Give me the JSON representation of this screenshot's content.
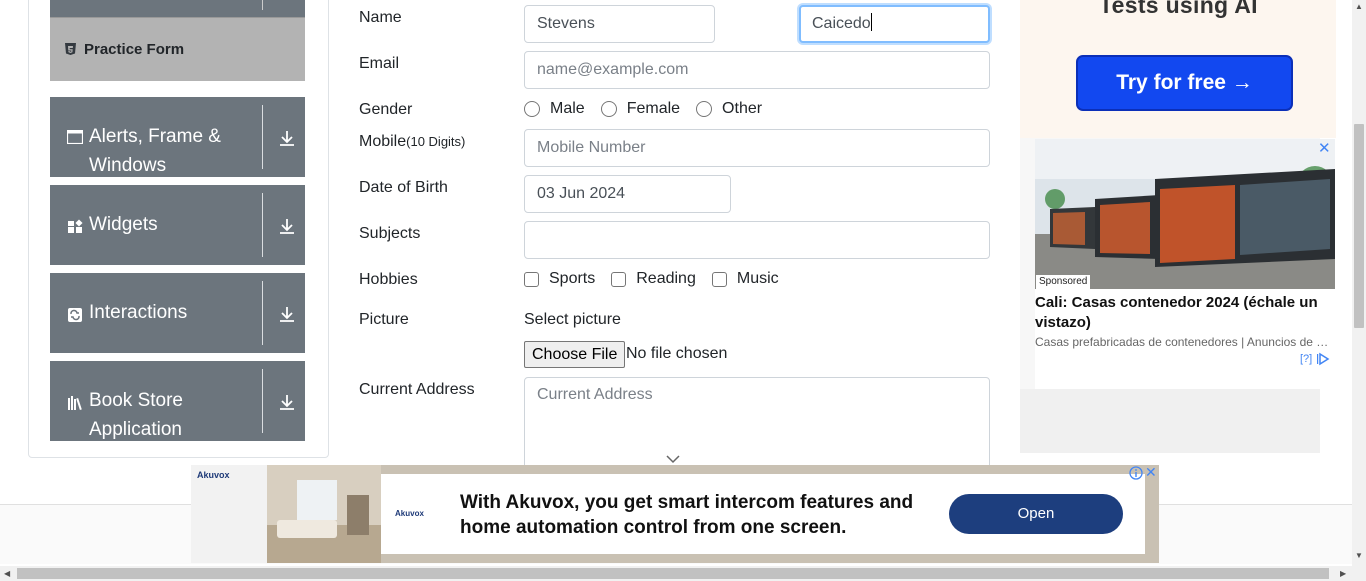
{
  "sidebar": {
    "active_item": "Practice Form",
    "groups": [
      {
        "label": "Alerts, Frame & Windows",
        "icon": "window-icon"
      },
      {
        "label": "Widgets",
        "icon": "widgets-icon"
      },
      {
        "label": "Interactions",
        "icon": "interactions-icon"
      },
      {
        "label": "Book Store Application",
        "icon": "books-icon"
      }
    ],
    "expand_icon": "download-arrow-icon"
  },
  "form": {
    "name_label": "Name",
    "first_name_value": "Stevens",
    "last_name_value": "Caicedo",
    "email_label": "Email",
    "email_placeholder": "name@example.com",
    "gender_label": "Gender",
    "gender_options": [
      "Male",
      "Female",
      "Other"
    ],
    "mobile_label": "Mobile",
    "mobile_hint": "(10 Digits)",
    "mobile_placeholder": "Mobile Number",
    "dob_label": "Date of Birth",
    "dob_value": "03 Jun 2024",
    "subjects_label": "Subjects",
    "subjects_value": "",
    "hobbies_label": "Hobbies",
    "hobbies_options": [
      "Sports",
      "Reading",
      "Music"
    ],
    "picture_label": "Picture",
    "select_picture_label": "Select picture",
    "choose_file_label": "Choose File",
    "file_status": "No file chosen",
    "address_label": "Current Address",
    "address_placeholder": "Current Address"
  },
  "right_ad": {
    "title": "Tests using AI",
    "cta": "Try for free →",
    "card_title": "Cali: Casas contenedor 2024 (échale un vistazo)",
    "card_subtitle": "Casas prefabricadas de contenedores | Anuncios de búsqueda",
    "sponsored": "Sponsored",
    "help": "[?]",
    "close": "✕"
  },
  "bottom_ad": {
    "brand": "Akuvox",
    "logo_text": "Akuvox",
    "text": "With Akuvox, you get smart intercom features and home automation control from one screen.",
    "button": "Open",
    "close": "✕"
  },
  "colors": {
    "sidebar_group": "#6c757d",
    "sidebar_active": "#b3b3b3",
    "focus_border": "#80bdff",
    "try_button": "#1248f0",
    "banner_button": "#1d3e7e"
  }
}
